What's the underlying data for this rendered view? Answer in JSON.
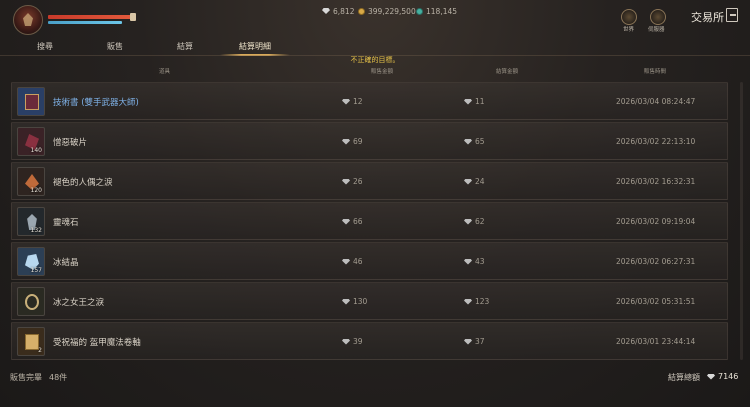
{
  "header": {
    "market_title": "交易所",
    "currencies": [
      {
        "icon": "diamond-icon",
        "value": "6,812"
      },
      {
        "icon": "gold-coin-icon",
        "value": "399,229,500"
      },
      {
        "icon": "green-coin-icon",
        "value": "118,145"
      }
    ],
    "shortcuts": [
      {
        "label": "世界",
        "icon": "world-icon"
      },
      {
        "label": "伺服器",
        "icon": "server-icon"
      }
    ],
    "hp_level": 1.0,
    "mp_level": 0.88
  },
  "tabs": [
    {
      "label": "搜尋",
      "active": false
    },
    {
      "label": "販售",
      "active": false
    },
    {
      "label": "結算",
      "active": false
    },
    {
      "label": "結算明細",
      "active": true
    }
  ],
  "error_message": "不正確的目標。",
  "columns": {
    "item": "道具",
    "sale_amount": "販售金額",
    "settle_amount": "結算金額",
    "sale_time": "販售時間"
  },
  "rows": [
    {
      "name": "技術書 (雙手武器大師)",
      "qty": "",
      "sale": "12",
      "settle": "11",
      "time": "2026/03/04 08:24:47",
      "link": true,
      "icon": "book-icon",
      "icon_color": "#2a3f66"
    },
    {
      "name": "憎惡破片",
      "qty": "140",
      "sale": "69",
      "settle": "65",
      "time": "2026/03/02 22:13:10",
      "link": false,
      "icon": "shard-icon",
      "icon_color": "#5a2a2e"
    },
    {
      "name": "褪色的人偶之淚",
      "qty": "120",
      "sale": "26",
      "settle": "24",
      "time": "2026/03/02 16:32:31",
      "link": false,
      "icon": "tear-icon",
      "icon_color": "#4a3026"
    },
    {
      "name": "靈魂石",
      "qty": "132",
      "sale": "66",
      "settle": "62",
      "time": "2026/03/02 09:19:04",
      "link": false,
      "icon": "crystal-icon",
      "icon_color": "#2c3338"
    },
    {
      "name": "冰結晶",
      "qty": "157",
      "sale": "46",
      "settle": "43",
      "time": "2026/03/02 06:27:31",
      "link": false,
      "icon": "ice-crystal-icon",
      "icon_color": "#3b5f86"
    },
    {
      "name": "冰之女王之淚",
      "qty": "",
      "sale": "130",
      "settle": "123",
      "time": "2026/03/02 05:31:51",
      "link": false,
      "icon": "ornament-icon",
      "icon_color": "#3a3a2e"
    },
    {
      "name": "受祝福的 盔甲魔法卷軸",
      "qty": "2",
      "sale": "39",
      "settle": "37",
      "time": "2026/03/01 23:44:14",
      "link": false,
      "icon": "scroll-icon",
      "icon_color": "#5a4426"
    }
  ],
  "footer": {
    "sold_label": "販售完畢",
    "sold_count": "48件",
    "total_label": "結算總額",
    "total_value": "7146"
  }
}
